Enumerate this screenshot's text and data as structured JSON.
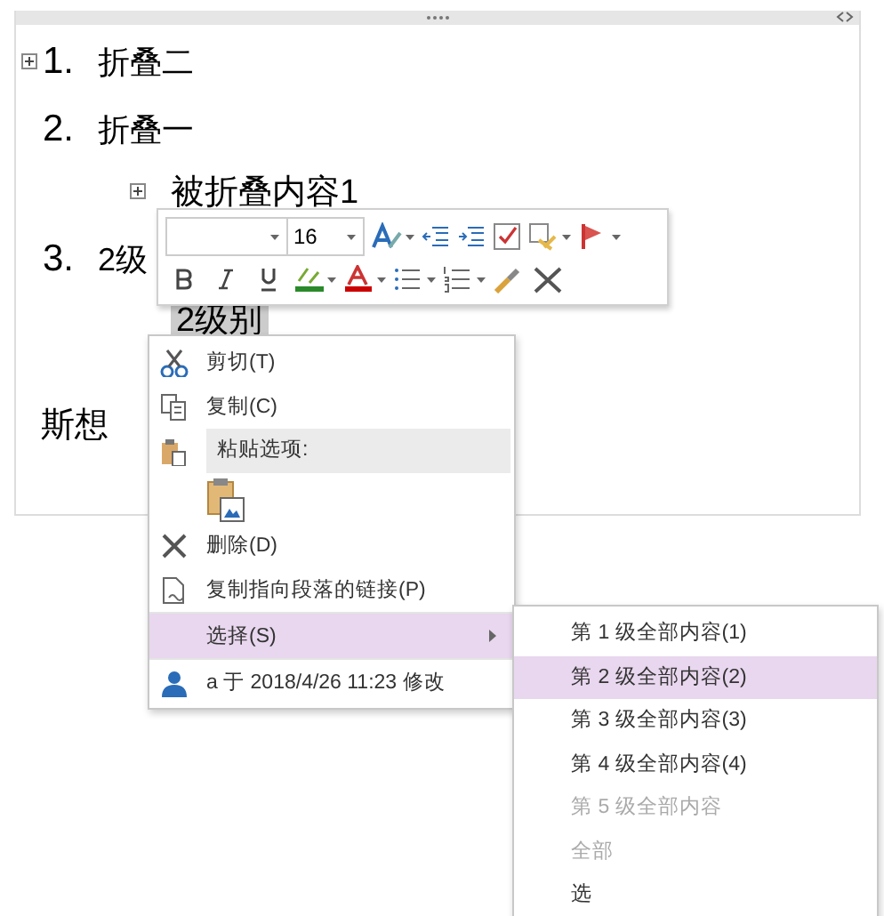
{
  "outline": [
    {
      "number": "1.",
      "text": "折叠二",
      "collapsed": true
    },
    {
      "number": "2.",
      "text": "折叠一",
      "collapsed": false,
      "children": [
        {
          "text": "被折叠内容1",
          "collapsed": true,
          "highlighted": false
        }
      ]
    },
    {
      "number": "3.",
      "text": "2级",
      "collapsed": false,
      "children": [
        {
          "text": "2级别",
          "collapsed": false,
          "highlighted": true
        }
      ]
    }
  ],
  "footer_text": "斯想",
  "mini_toolbar": {
    "font_size": "16"
  },
  "context_menu": [
    {
      "kind": "cut",
      "label": "剪切(T)",
      "selected": false
    },
    {
      "kind": "copy",
      "label": "复制(C)",
      "selected": false
    },
    {
      "kind": "paste-header",
      "label": "粘贴选项:",
      "selected": false
    },
    {
      "kind": "paste-options",
      "selected": false
    },
    {
      "kind": "delete",
      "label": "删除(D)",
      "selected": false
    },
    {
      "kind": "link",
      "label": "复制指向段落的链接(P)",
      "selected": false
    },
    {
      "kind": "submenu",
      "label": "选择(S)",
      "selected": true
    },
    {
      "kind": "info",
      "label": "a 于 2018/4/26 11:23 修改",
      "selected": false
    }
  ],
  "submenu": [
    {
      "label": "第 1 级全部内容(1)",
      "selected": false,
      "disabled": false
    },
    {
      "label": "第 2 级全部内容(2)",
      "selected": true,
      "disabled": false
    },
    {
      "label": "第 3 级全部内容(3)",
      "selected": false,
      "disabled": false
    },
    {
      "label": "第 4 级全部内容(4)",
      "selected": false,
      "disabled": false
    },
    {
      "label": "第 5 级全部内容",
      "selected": false,
      "disabled": true
    },
    {
      "label": "全部",
      "selected": false,
      "disabled": true
    },
    {
      "label": "选",
      "selected": false,
      "disabled": false
    }
  ]
}
